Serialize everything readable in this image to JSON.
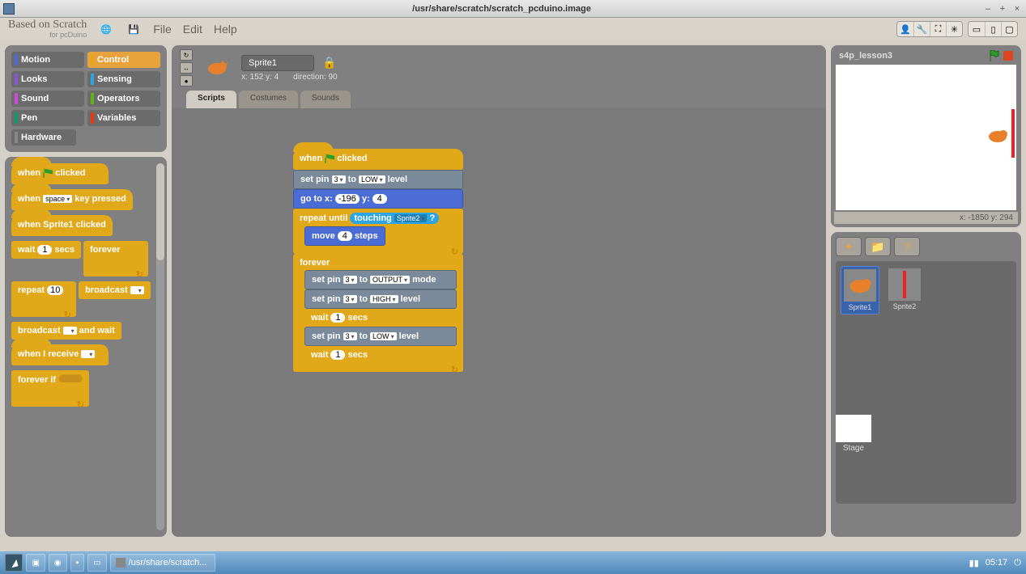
{
  "window": {
    "title": "/usr/share/scratch/scratch_pcduino.image",
    "minimize": "–",
    "maximize": "+",
    "close": "×"
  },
  "app": {
    "title": "Based on Scratch",
    "subtitle": "for pcDuino"
  },
  "menu": {
    "file": "File",
    "edit": "Edit",
    "help": "Help"
  },
  "categories": {
    "motion": "Motion",
    "control": "Control",
    "looks": "Looks",
    "sensing": "Sensing",
    "sound": "Sound",
    "operators": "Operators",
    "pen": "Pen",
    "variables": "Variables",
    "hardware": "Hardware"
  },
  "palette": {
    "when_flag_clicked_pre": "when ",
    "when_flag_clicked_post": " clicked",
    "when_key_pressed_pre": "when ",
    "when_key_pressed_key": "space",
    "when_key_pressed_post": " key pressed",
    "when_sprite_clicked": "when Sprite1 clicked",
    "wait_pre": "wait ",
    "wait_val": "1",
    "wait_post": " secs",
    "forever": "forever",
    "repeat_pre": "repeat ",
    "repeat_val": "10",
    "broadcast": "broadcast ",
    "broadcast_wait_pre": "broadcast ",
    "broadcast_wait_post": " and wait",
    "when_receive": "when I receive ",
    "forever_if": "forever if "
  },
  "sprite": {
    "name": "Sprite1",
    "coords": "x: 152  y: 4",
    "direction": "direction: 90"
  },
  "tabs": {
    "scripts": "Scripts",
    "costumes": "Costumes",
    "sounds": "Sounds"
  },
  "script": {
    "when_clicked": " clicked",
    "when": "when ",
    "set_pin": "set pin ",
    "pin_val": "3",
    "to": " to ",
    "low": "LOW",
    "level": " level",
    "goto_pre": "go to x: ",
    "goto_x": "-196",
    "goto_mid": " y: ",
    "goto_y": "4",
    "repeat_until": "repeat until ",
    "touching": "touching ",
    "touching_arg": "Sprite2",
    "touching_q": " ?",
    "move_pre": "move ",
    "move_val": "4",
    "move_post": " steps",
    "forever": "forever",
    "output": "OUTPUT",
    "mode": " mode",
    "high": "HIGH",
    "wait_pre": "wait ",
    "wait_val": "1",
    "wait_post": " secs"
  },
  "stage": {
    "project": "s4p_lesson3",
    "coords": "x: -1850  y: 294",
    "sprite1": "Sprite1",
    "sprite2": "Sprite2",
    "stage_label": "Stage"
  },
  "taskbar": {
    "app": "/usr/share/scratch...",
    "time": "05:17"
  }
}
